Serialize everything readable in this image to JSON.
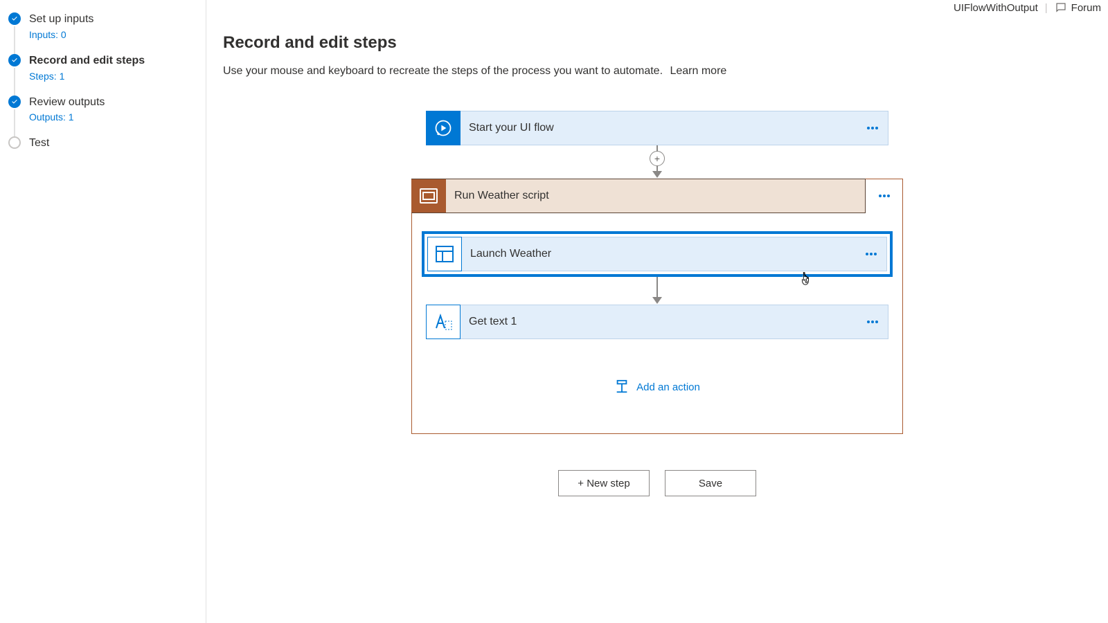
{
  "header": {
    "flow_name": "UIFlowWithOutput",
    "forum_label": "Forum"
  },
  "sidebar": {
    "items": [
      {
        "title": "Set up inputs",
        "subtitle": "Inputs: 0",
        "state": "done"
      },
      {
        "title": "Record and edit steps",
        "subtitle": "Steps: 1",
        "state": "done",
        "active": true
      },
      {
        "title": "Review outputs",
        "subtitle": "Outputs: 1",
        "state": "done"
      },
      {
        "title": "Test",
        "subtitle": "",
        "state": "pending"
      }
    ]
  },
  "page": {
    "title": "Record and edit steps",
    "description": "Use your mouse and keyboard to recreate the steps of the process you want to automate.",
    "learn_more": "Learn more"
  },
  "flow": {
    "start_label": "Start your UI flow",
    "scope_label": "Run Weather script",
    "actions": [
      {
        "label": "Launch Weather",
        "selected": true
      },
      {
        "label": "Get text 1",
        "selected": false
      }
    ],
    "add_action_label": "Add an action"
  },
  "buttons": {
    "new_step": "+ New step",
    "save": "Save"
  }
}
